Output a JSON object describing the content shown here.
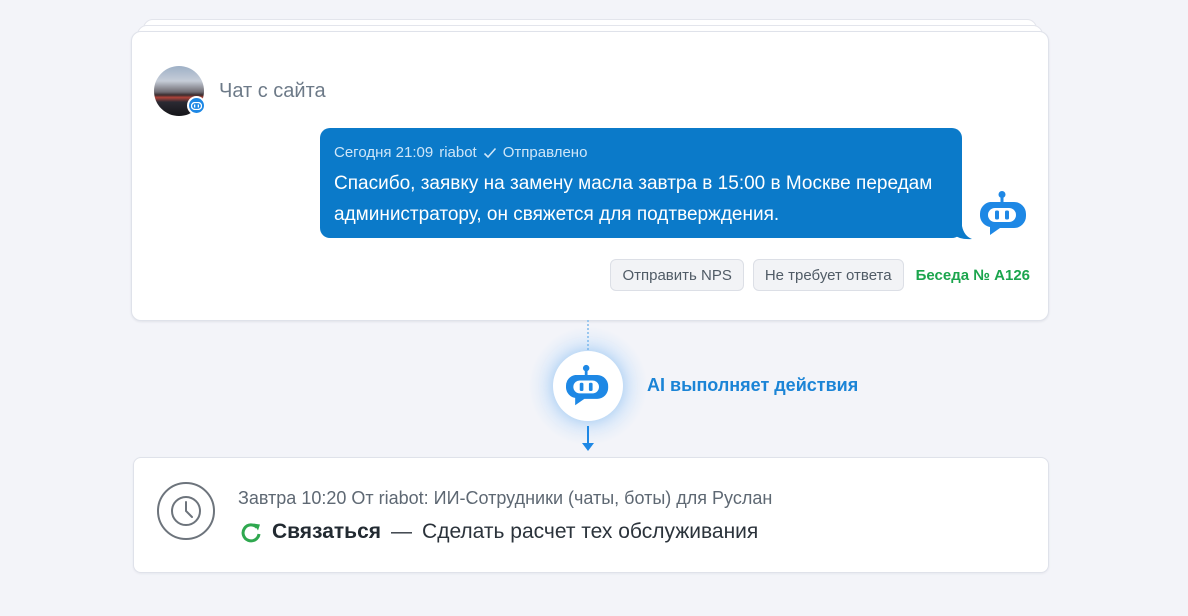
{
  "chat": {
    "channel_title": "Чат с сайта",
    "message": {
      "date": "Сегодня 21:09",
      "sender": "riabot",
      "status": "Отправлено",
      "text": "Спасибо, заявку на замену масла завтра в 15:00 в Москве передам администратору, он свяжется для подтверждения."
    },
    "actions": {
      "send_nps": "Отправить NPS",
      "no_reply": "Не требует ответа",
      "conversation": "Беседа № А126"
    }
  },
  "ai": {
    "label": "AI выполняет действия"
  },
  "task": {
    "meta": "Завтра 10:20 От riabot: ИИ-Сотрудники (чаты, боты) для Руслан",
    "action": "Связаться",
    "separator": "—",
    "description": "Сделать расчет тех обслуживания"
  },
  "colors": {
    "bubble": "#0b7ac9",
    "accent_blue": "#1b84d6",
    "conversation_green": "#1ba54d",
    "refresh_green": "#2fa84f"
  },
  "icons": [
    "bot-icon",
    "checkmark-icon",
    "clock-icon",
    "refresh-icon",
    "arrow-down-icon"
  ]
}
